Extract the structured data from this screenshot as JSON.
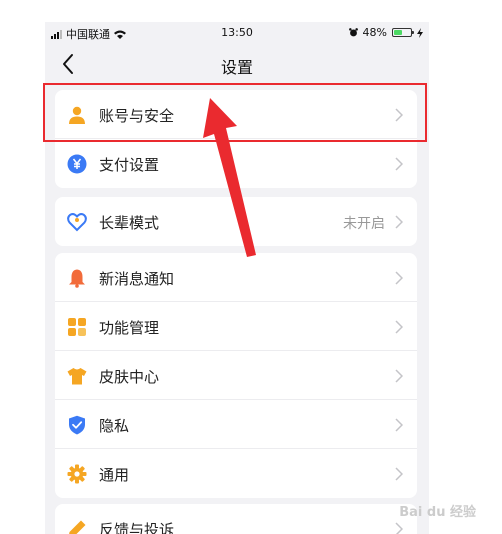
{
  "status_bar": {
    "carrier": "中国联通",
    "time": "13:50",
    "battery": "48%",
    "battery_level": 0.48
  },
  "nav": {
    "title": "设置",
    "back_icon": "chevron-left-icon"
  },
  "groups": [
    {
      "items": [
        {
          "label": "账号与安全",
          "icon": "user-icon",
          "color": "#f5a623"
        },
        {
          "label": "支付设置",
          "icon": "yuan-icon",
          "color": "#3b7af5"
        }
      ]
    },
    {
      "items": [
        {
          "label": "长辈模式",
          "value": "未开启",
          "icon": "heart-icon",
          "color": "#3b7af5"
        }
      ]
    },
    {
      "items": [
        {
          "label": "新消息通知",
          "icon": "bell-icon",
          "color": "#f26b3a"
        },
        {
          "label": "功能管理",
          "icon": "grid-icon",
          "color": "#f5a623"
        },
        {
          "label": "皮肤中心",
          "icon": "shirt-icon",
          "color": "#f5a623"
        },
        {
          "label": "隐私",
          "icon": "shield-icon",
          "color": "#3b7af5"
        },
        {
          "label": "通用",
          "icon": "gear-icon",
          "color": "#f5a623"
        }
      ]
    },
    {
      "items": [
        {
          "label": "反馈与投诉",
          "icon": "pencil-icon",
          "color": "#f5a623"
        }
      ]
    }
  ],
  "colors": {
    "highlight": "#ea2a2f",
    "accent_blue": "#3b7af5",
    "accent_orange": "#f5a623"
  }
}
